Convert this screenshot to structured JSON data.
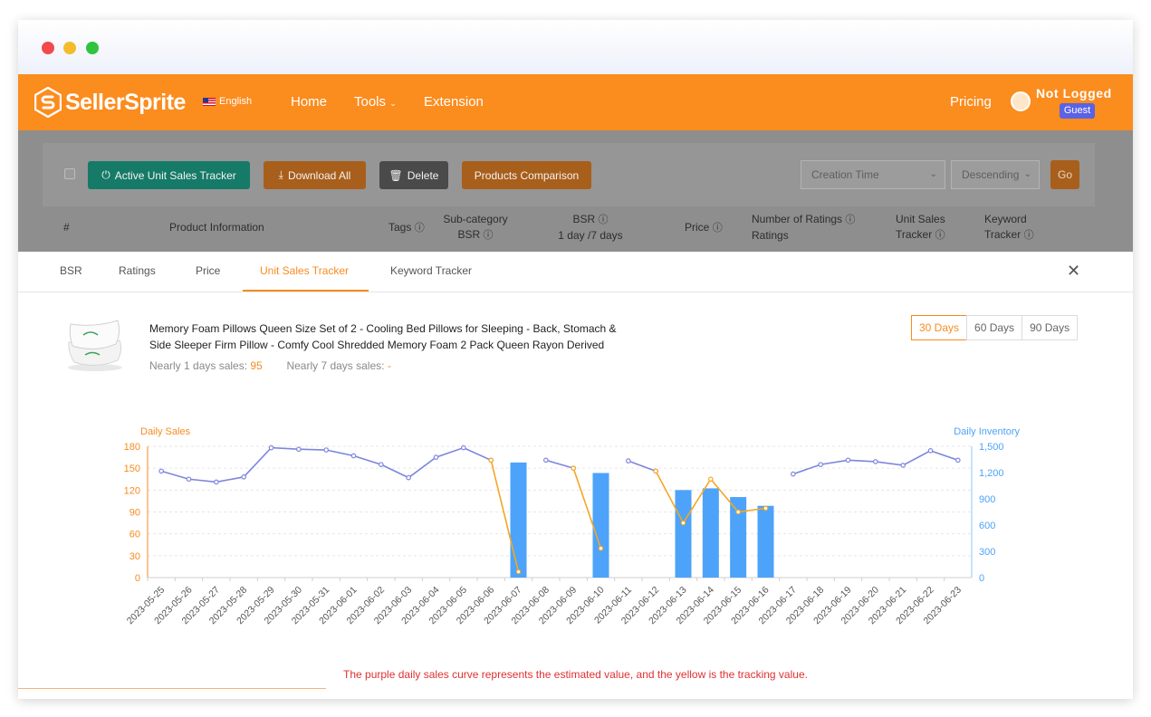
{
  "brand": {
    "name": "SellerSprite",
    "accent": "#fb8c1e",
    "indigo": "#5b62e6"
  },
  "nav": {
    "language": "English",
    "items": [
      "Home",
      "Tools",
      "Extension"
    ],
    "pricing": "Pricing",
    "user_status": "Not Logged",
    "user_badge": "Guest"
  },
  "toolbar": {
    "active_tracker": "Active Unit Sales Tracker",
    "download_all": "Download All",
    "delete": "Delete",
    "products_comparison": "Products Comparison",
    "sort_field": "Creation Time",
    "sort_order": "Descending",
    "go": "Go"
  },
  "table_headers": {
    "index": "#",
    "product_info": "Product Information",
    "tags": "Tags",
    "subcat_1": "Sub-category",
    "subcat_2": "BSR",
    "bsr_1": "BSR",
    "bsr_2": "1 day /7 days",
    "price": "Price",
    "ratings_1": "Number of Ratings",
    "ratings_2": "Ratings",
    "ust_1": "Unit Sales",
    "ust_2": "Tracker",
    "kt_1": "Keyword",
    "kt_2": "Tracker"
  },
  "tabs": [
    "BSR",
    "Ratings",
    "Price",
    "Unit Sales Tracker",
    "Keyword Tracker"
  ],
  "active_tab": "Unit Sales Tracker",
  "product": {
    "title_line1": "Memory Foam Pillows Queen Size Set of 2 - Cooling Bed Pillows for Sleeping - Back, Stomach &",
    "title_line2": "Side Sleeper Firm Pillow - Comfy Cool Shredded Memory Foam 2 Pack Queen Rayon Derived",
    "sales_1d_label": "Nearly 1 days sales:",
    "sales_1d_value": "95",
    "sales_7d_label": "Nearly 7 days sales:",
    "sales_7d_value": "-"
  },
  "day_ranges": [
    "30 Days",
    "60 Days",
    "90 Days"
  ],
  "selected_range": "30 Days",
  "chart_data": {
    "type": "bar",
    "left_axis_label": "Daily Sales",
    "right_axis_label": "Daily Inventory",
    "ylim_left": [
      0,
      180
    ],
    "ylim_right": [
      0,
      1500
    ],
    "yticks_left": [
      "0",
      "30",
      "60",
      "90",
      "120",
      "150",
      "180"
    ],
    "yticks_right": [
      "0",
      "300",
      "600",
      "900",
      "1,200",
      "1,500"
    ],
    "categories": [
      "2023-05-25",
      "2023-05-26",
      "2023-05-27",
      "2023-05-28",
      "2023-05-29",
      "2023-05-30",
      "2023-05-31",
      "2023-06-01",
      "2023-06-02",
      "2023-06-03",
      "2023-06-04",
      "2023-06-05",
      "2023-06-06",
      "2023-06-07",
      "2023-06-08",
      "2023-06-09",
      "2023-06-10",
      "2023-06-11",
      "2023-06-12",
      "2023-06-13",
      "2023-06-14",
      "2023-06-15",
      "2023-06-16",
      "2023-06-17",
      "2023-06-18",
      "2023-06-19",
      "2023-06-20",
      "2023-06-21",
      "2023-06-22",
      "2023-06-23"
    ],
    "series": [
      {
        "role": "inventory-bars",
        "axis": "right",
        "color": "#4da3fa",
        "values": [
          null,
          null,
          null,
          null,
          null,
          null,
          null,
          null,
          null,
          null,
          null,
          null,
          null,
          1315,
          null,
          null,
          1195,
          null,
          null,
          1000,
          1020,
          920,
          820,
          null,
          null,
          null,
          null,
          null,
          null,
          null
        ]
      },
      {
        "role": "estimated-sales",
        "axis": "left",
        "color": "#7d86dd",
        "values": [
          146,
          135,
          131,
          138,
          178,
          176,
          175,
          167,
          155,
          137,
          165,
          178,
          161,
          null,
          161,
          150,
          null,
          160,
          146,
          null,
          null,
          null,
          null,
          142,
          155,
          161,
          159,
          154,
          174,
          161
        ]
      },
      {
        "role": "tracked-sales",
        "axis": "left",
        "color": "#f5a623",
        "values": [
          null,
          null,
          null,
          null,
          null,
          null,
          null,
          null,
          null,
          null,
          null,
          null,
          161,
          8,
          null,
          150,
          40,
          null,
          146,
          75,
          135,
          90,
          95,
          null,
          null,
          null,
          null,
          null,
          null,
          null
        ]
      }
    ],
    "grid": true
  },
  "note": "The purple daily sales curve represents the estimated value, and the yellow is the tracking value."
}
